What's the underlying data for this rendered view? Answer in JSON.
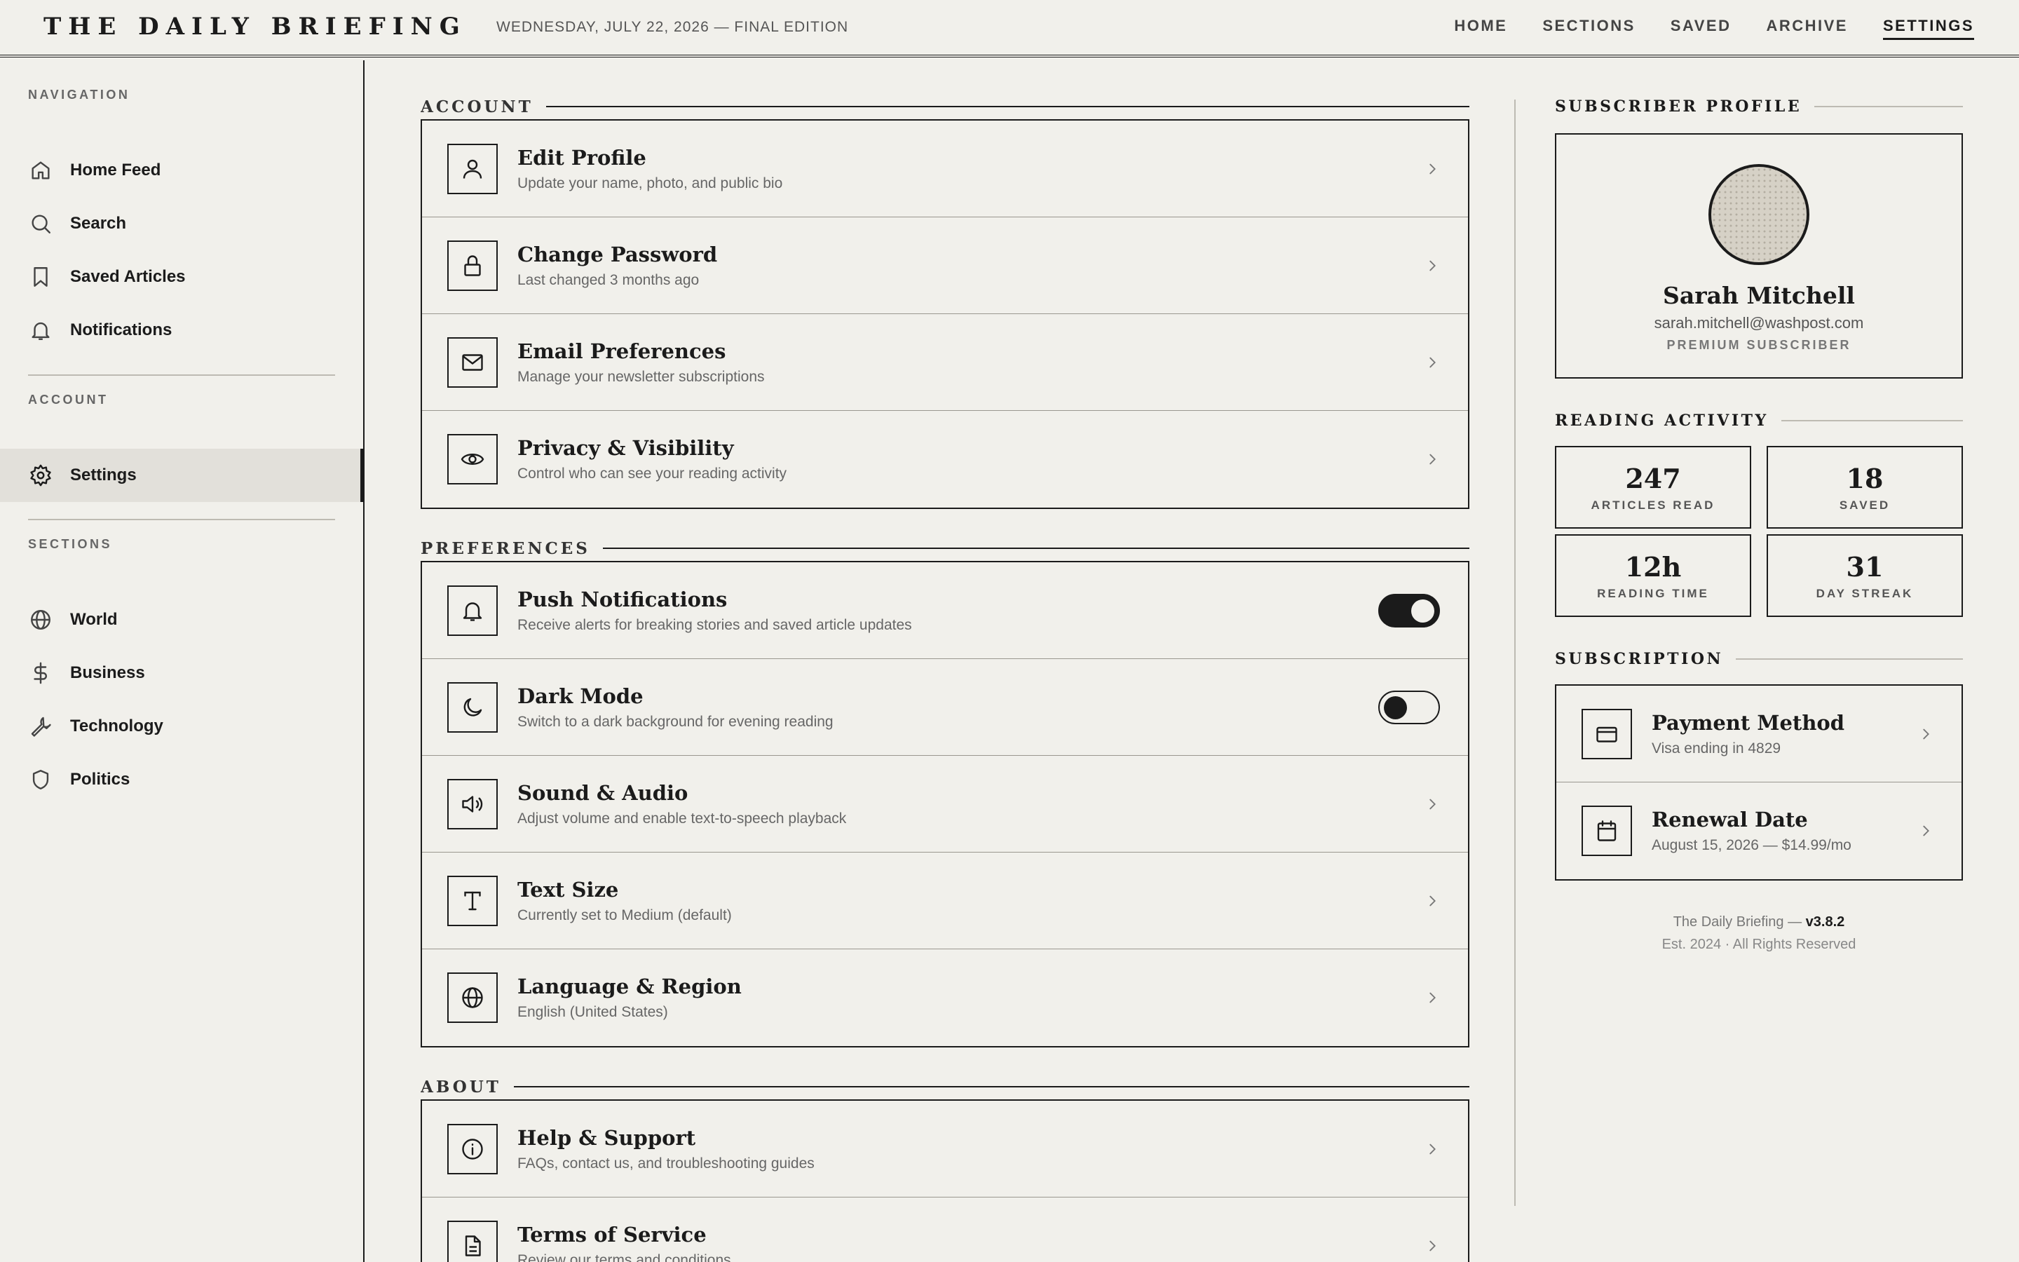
{
  "header": {
    "masthead": "THE DAILY BRIEFING",
    "dateline": "WEDNESDAY, JULY 22, 2026 — FINAL EDITION",
    "nav": [
      {
        "label": "HOME",
        "active": false
      },
      {
        "label": "SECTIONS",
        "active": false
      },
      {
        "label": "SAVED",
        "active": false
      },
      {
        "label": "ARCHIVE",
        "active": false
      },
      {
        "label": "SETTINGS",
        "active": true
      }
    ]
  },
  "sidebar": {
    "navigation_heading": "NAVIGATION",
    "navigation": [
      {
        "label": "Home Feed",
        "icon": "home-icon"
      },
      {
        "label": "Search",
        "icon": "search-icon"
      },
      {
        "label": "Saved Articles",
        "icon": "bookmark-icon"
      },
      {
        "label": "Notifications",
        "icon": "bell-icon"
      }
    ],
    "account_heading": "ACCOUNT",
    "account": [
      {
        "label": "Settings",
        "icon": "gear-icon",
        "active": true
      }
    ],
    "sections_heading": "SECTIONS",
    "sections": [
      {
        "label": "World",
        "icon": "globe-icon"
      },
      {
        "label": "Business",
        "icon": "dollar-icon"
      },
      {
        "label": "Technology",
        "icon": "wrench-icon"
      },
      {
        "label": "Politics",
        "icon": "shield-icon"
      }
    ]
  },
  "main": {
    "account": {
      "heading": "ACCOUNT",
      "rows": [
        {
          "title": "Edit Profile",
          "subtitle": "Update your name, photo, and public bio",
          "icon": "user-icon"
        },
        {
          "title": "Change Password",
          "subtitle": "Last changed 3 months ago",
          "icon": "lock-icon"
        },
        {
          "title": "Email Preferences",
          "subtitle": "Manage your newsletter subscriptions",
          "icon": "mail-icon"
        },
        {
          "title": "Privacy & Visibility",
          "subtitle": "Control who can see your reading activity",
          "icon": "eye-icon"
        }
      ]
    },
    "preferences": {
      "heading": "PREFERENCES",
      "rows": [
        {
          "title": "Push Notifications",
          "subtitle": "Receive alerts for breaking stories and saved article updates",
          "icon": "bell-icon",
          "toggle": "on"
        },
        {
          "title": "Dark Mode",
          "subtitle": "Switch to a dark background for evening reading",
          "icon": "moon-icon",
          "toggle": "off"
        },
        {
          "title": "Sound & Audio",
          "subtitle": "Adjust volume and enable text-to-speech playback",
          "icon": "speaker-icon"
        },
        {
          "title": "Text Size",
          "subtitle": "Currently set to Medium (default)",
          "icon": "text-icon"
        },
        {
          "title": "Language & Region",
          "subtitle": "English (United States)",
          "icon": "globe-icon"
        }
      ]
    },
    "about": {
      "heading": "ABOUT",
      "rows": [
        {
          "title": "Help & Support",
          "subtitle": "FAQs, contact us, and troubleshooting guides",
          "icon": "info-icon"
        },
        {
          "title": "Terms of Service",
          "subtitle": "Review our terms and conditions",
          "icon": "document-icon"
        }
      ]
    }
  },
  "right": {
    "profile_heading": "SUBSCRIBER PROFILE",
    "profile": {
      "name": "Sarah Mitchell",
      "email": "sarah.mitchell@washpost.com",
      "tier": "PREMIUM SUBSCRIBER"
    },
    "activity_heading": "READING ACTIVITY",
    "stats": [
      {
        "value": "247",
        "label": "ARTICLES READ"
      },
      {
        "value": "18",
        "label": "SAVED"
      },
      {
        "value": "12h",
        "label": "READING TIME"
      },
      {
        "value": "31",
        "label": "DAY STREAK"
      }
    ],
    "subscription_heading": "SUBSCRIPTION",
    "subscription": [
      {
        "title": "Payment Method",
        "subtitle": "Visa ending in 4829",
        "icon": "credit-card-icon"
      },
      {
        "title": "Renewal Date",
        "subtitle": "August 15, 2026 — $14.99/mo",
        "icon": "calendar-icon"
      }
    ],
    "footer": {
      "line1_prefix": "The Daily Briefing — ",
      "version": "v3.8.2",
      "line2": "Est. 2024 · All Rights Reserved"
    }
  },
  "colors": {
    "background": "#f1f0eb",
    "ink": "#1b1b1b",
    "muted": "#666666",
    "active_bg": "#e2e0da"
  }
}
